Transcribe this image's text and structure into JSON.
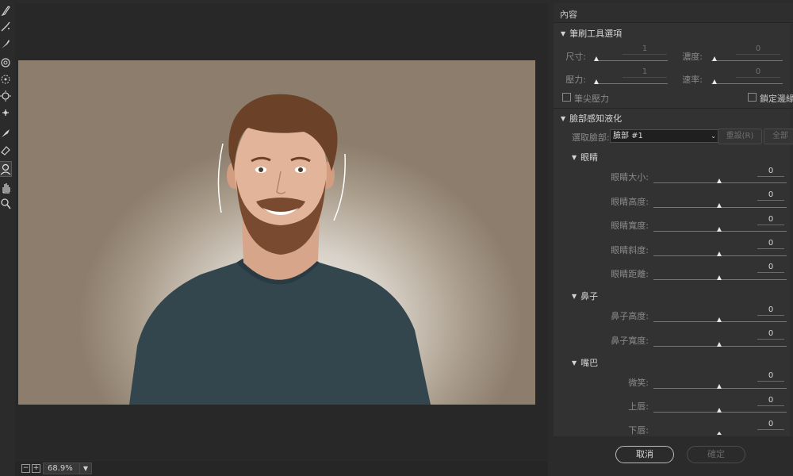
{
  "toolbar": {
    "tools": [
      {
        "icon": "forward-warp-icon"
      },
      {
        "icon": "reconstruct-icon"
      },
      {
        "icon": "smooth-icon"
      },
      {
        "icon": "twirl-clockwise-icon"
      },
      {
        "icon": "pucker-icon"
      },
      {
        "icon": "bloat-icon"
      },
      {
        "icon": "push-left-icon"
      },
      {
        "icon": "freeze-mask-icon"
      },
      {
        "icon": "thaw-mask-icon"
      },
      {
        "icon": "face-tool-icon"
      },
      {
        "icon": "hand-icon"
      },
      {
        "icon": "zoom-icon"
      }
    ],
    "active_index": 9
  },
  "status": {
    "zoom_value": "68.9%",
    "zoom_out": "−",
    "zoom_in": "+"
  },
  "panel": {
    "header": "內容",
    "brush_section": {
      "title": "筆刷工具選項",
      "size_label": "尺寸:",
      "size_value": "1",
      "density_label": "濃度:",
      "density_value": "0",
      "pressure_label": "壓力:",
      "pressure_value": "1",
      "rate_label": "速率:",
      "rate_value": "0",
      "stylus_label": "筆尖壓力",
      "pin_edges_label": "鎖定邊緣"
    },
    "face_section": {
      "title": "臉部感知液化",
      "select_face_label": "選取臉部:",
      "select_face_value": "臉部 #1",
      "reset_label": "重設(R)",
      "all_label": "全部"
    },
    "eyes": {
      "title": "眼睛",
      "rows": [
        {
          "label": "眼睛大小:",
          "value": "0"
        },
        {
          "label": "眼睛高度:",
          "value": "0"
        },
        {
          "label": "眼睛寬度:",
          "value": "0"
        },
        {
          "label": "眼睛斜度:",
          "value": "0"
        },
        {
          "label": "眼睛距離:",
          "value": "0"
        }
      ]
    },
    "nose": {
      "title": "鼻子",
      "rows": [
        {
          "label": "鼻子高度:",
          "value": "0"
        },
        {
          "label": "鼻子寬度:",
          "value": "0"
        }
      ]
    },
    "mouth": {
      "title": "嘴巴",
      "rows": [
        {
          "label": "微笑:",
          "value": "0"
        },
        {
          "label": "上唇:",
          "value": "0"
        },
        {
          "label": "下唇:",
          "value": "0"
        }
      ]
    }
  },
  "footer": {
    "cancel_label": "取消",
    "ok_label": "確定"
  }
}
